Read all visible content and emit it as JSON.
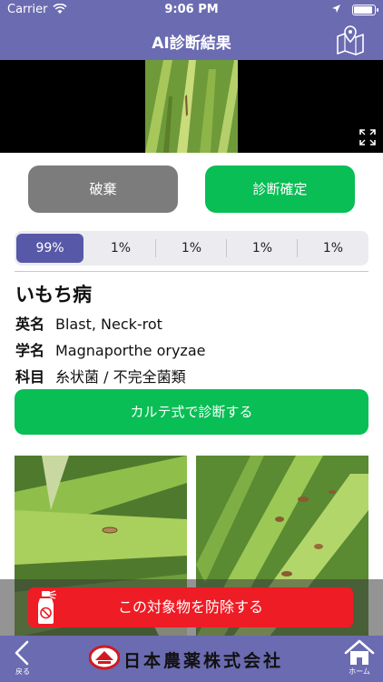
{
  "status_bar": {
    "carrier": "Carrier",
    "time": "9:06 PM"
  },
  "nav": {
    "title": "AI診断結果"
  },
  "actions": {
    "discard_label": "破棄",
    "confirm_label": "診断確定"
  },
  "segments": [
    "99%",
    "1%",
    "1%",
    "1%",
    "1%"
  ],
  "selected_segment": "99%",
  "result": {
    "name": "いもち病",
    "rows": [
      {
        "key": "英名",
        "value": "Blast, Neck-rot"
      },
      {
        "key": "学名",
        "value": "Magnaporthe oryzae"
      },
      {
        "key": "科目",
        "value": "糸状菌 / 不完全菌類"
      }
    ]
  },
  "karte_button": "カルテ式で診断する",
  "protect_button": "この対象物を防除する",
  "tab_bar": {
    "back_label": "戻る",
    "brand": "日本農薬株式会社",
    "home_label": "ホーム"
  },
  "colors": {
    "nav": "#6b6bb2",
    "green": "#08be55",
    "red": "#ee1c25",
    "gray": "#7c7c7c",
    "segment_active": "#5858a8"
  },
  "icons": {
    "map": "map-pin-icon",
    "expand": "expand-icon",
    "back": "chevron-left-icon",
    "home": "home-icon",
    "spray": "spray-bottle-icon"
  }
}
